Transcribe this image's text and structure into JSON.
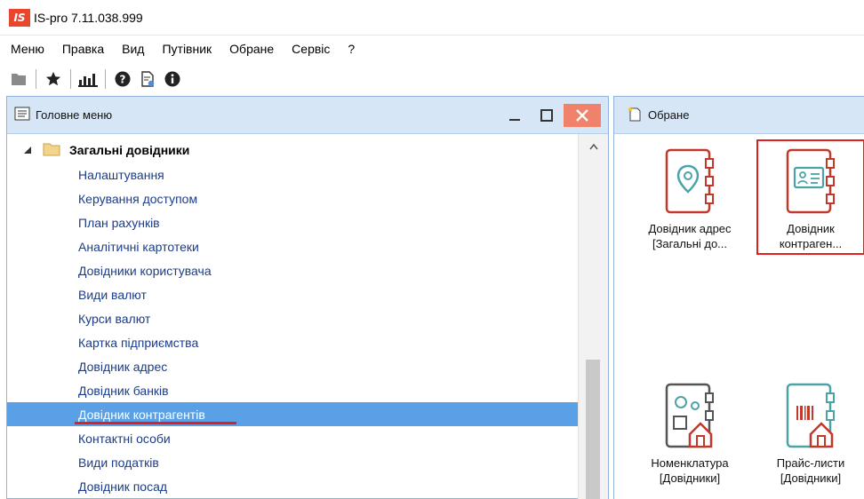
{
  "window": {
    "logo_text": "IS",
    "title": "IS-pro 7.11.038.999"
  },
  "menu": [
    "Меню",
    "Правка",
    "Вид",
    "Путівник",
    "Обране",
    "Сервіс",
    "?"
  ],
  "toolbar": {
    "icons": [
      "folder-icon",
      "star-icon",
      "chart-icon",
      "help-icon",
      "document-settings-icon",
      "info-icon"
    ]
  },
  "left_panel": {
    "title": "Головне меню",
    "tree_root": "Загальні довідники",
    "items": [
      "Налаштування",
      "Керування доступом",
      "План рахунків",
      "Аналітичні картотеки",
      "Довідники користувача",
      "Види валют",
      "Курси валют",
      "Картка підприємства",
      "Довідник адрес",
      "Довідник банків",
      "Довідник контрагентів",
      "Контактні особи",
      "Види податків",
      "Довідник посад"
    ],
    "selected_index": 10
  },
  "right_panel": {
    "title": "Обране",
    "tiles": [
      {
        "line1": "Довідник адрес",
        "line2": "[Загальні до..."
      },
      {
        "line1": "Довідник",
        "line2": "контраген..."
      },
      {
        "line1": "Номенклатура",
        "line2": "[Довідники]"
      },
      {
        "line1": "Прайс-листи",
        "line2": "[Довідники]"
      }
    ]
  },
  "colors": {
    "accent": "#d04040",
    "selection": "#5aa0e6",
    "header_bg": "#d6e6f7",
    "highlight_border": "#e02020"
  }
}
